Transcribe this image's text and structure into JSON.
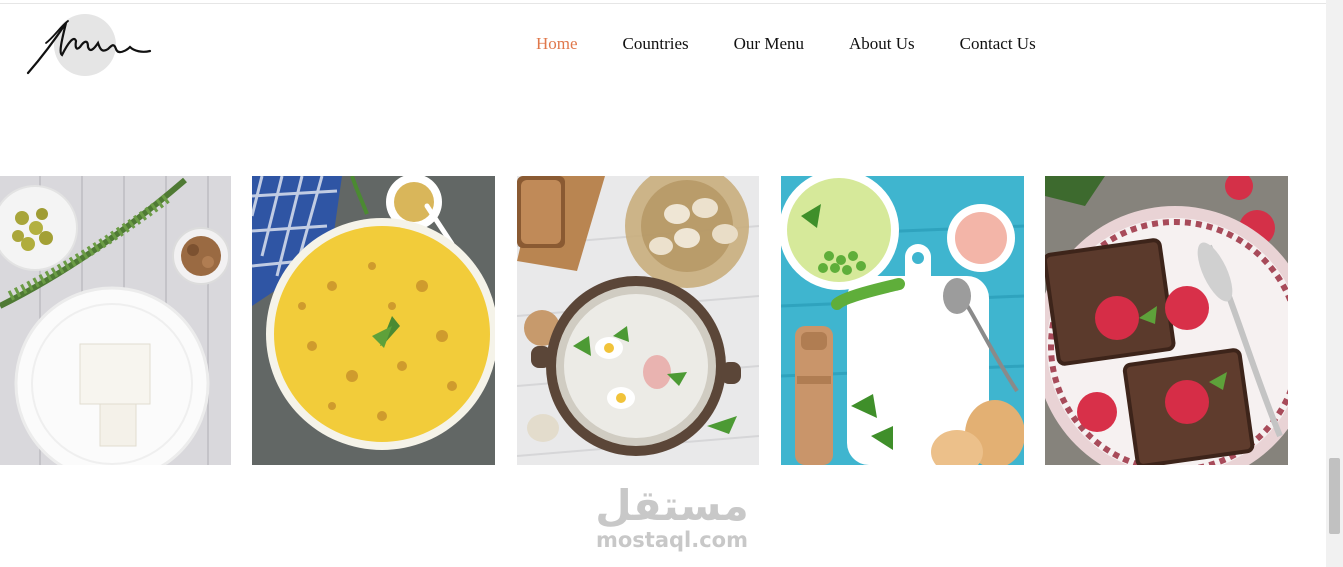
{
  "logo": {
    "icon": "signature-logo"
  },
  "nav": {
    "items": [
      {
        "label": "Home",
        "active": true
      },
      {
        "label": "Countries",
        "active": false
      },
      {
        "label": "Our Menu",
        "active": false
      },
      {
        "label": "About Us",
        "active": false
      },
      {
        "label": "Contact Us",
        "active": false
      }
    ]
  },
  "gallery": {
    "images": [
      {
        "subject": "feta cheese plate with dill, olives and walnuts"
      },
      {
        "subject": "baked potato gratin with checked napkin and mustard"
      },
      {
        "subject": "white soup with quail eggs and sausage"
      },
      {
        "subject": "green pea soup, cutting board, salt and pepper mill"
      },
      {
        "subject": "chocolate brownies with raspberries"
      }
    ]
  },
  "watermark": {
    "arabic": "مستقل",
    "latin": "mostaql.com"
  },
  "colors": {
    "accent": "#e0784b",
    "text": "#111111"
  }
}
